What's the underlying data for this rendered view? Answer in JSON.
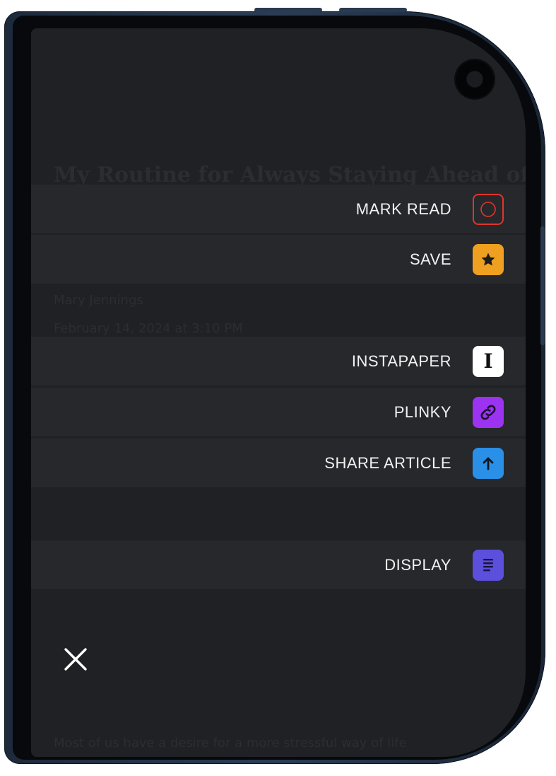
{
  "article": {
    "title": "My Routine for Always Staying Ahead of My",
    "author": "Mary Jennings",
    "date": "February 14, 2024 at 3:10 PM",
    "footer": "Most of us have a desire for a more stressful way of life"
  },
  "menu": {
    "mark_read": "MARK READ",
    "save": "SAVE",
    "instapaper": "INSTAPAPER",
    "instapaper_glyph": "I",
    "plinky": "PLINKY",
    "share_article": "SHARE ARTICLE",
    "display": "DISPLAY"
  },
  "icons": {
    "mark_read": "circle-icon",
    "save": "star-icon",
    "instapaper": "instapaper-icon",
    "plinky": "link-icon",
    "share_article": "arrow-up-icon",
    "display": "text-lines-icon",
    "close": "close-icon"
  },
  "colors": {
    "mark_read_border": "#e0352b",
    "save_bg": "#f0a020",
    "instapaper_bg": "#ffffff",
    "plinky_bg": "#9b33f0",
    "share_bg": "#2a8fe6",
    "display_bg": "#5b4fdc",
    "background": "#1f2124",
    "menu_row": "#26282c"
  }
}
